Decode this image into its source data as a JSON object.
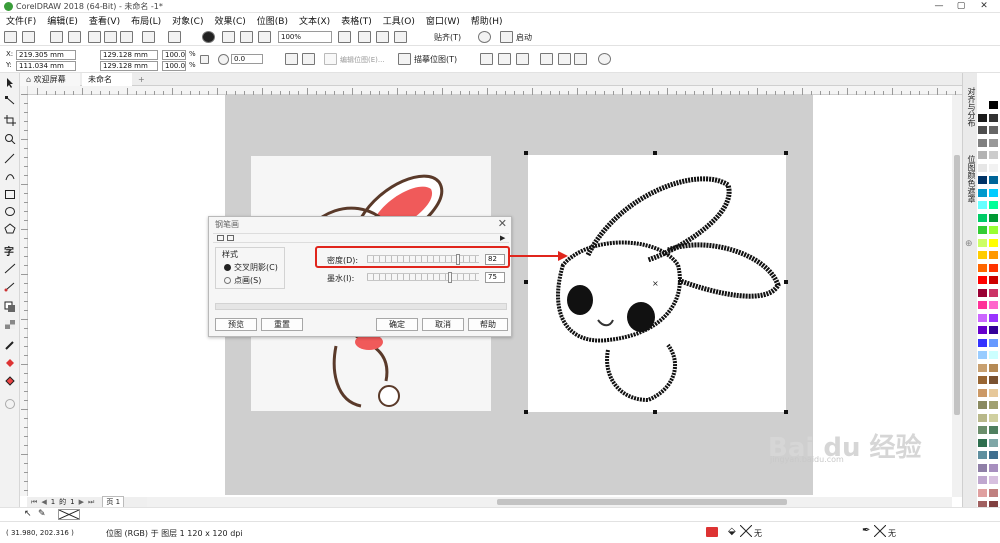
{
  "window": {
    "title": "CorelDRAW 2018 (64-Bit) - 未命名 -1*"
  },
  "menu": [
    "文件(F)",
    "编辑(E)",
    "查看(V)",
    "布局(L)",
    "对象(C)",
    "效果(C)",
    "位图(B)",
    "文本(X)",
    "表格(T)",
    "工具(O)",
    "窗口(W)",
    "帮助(H)"
  ],
  "toolbar": {
    "zoom": "100%",
    "snap_label": "贴齐(T)",
    "launch_label": "启动",
    "x": "219.305 mm",
    "y": "111.034 mm",
    "width": "129.128 mm",
    "height": "129.128 mm",
    "scale_w": "100.0",
    "scale_h": "100.0",
    "percent": "%",
    "rotation": "0.0",
    "edit_bitmap_label": "编辑位图(E)...",
    "trace_bitmap_label": "描摹位图(T)"
  },
  "tabs": {
    "welcome": "欢迎屏幕",
    "document": "未命名 -1*"
  },
  "dock": {
    "panel1": "对齐与分布",
    "panel2": "位图颜色遮罩"
  },
  "dialog": {
    "title": "钢笔画",
    "style_group": "样式",
    "option1": "交叉阴影(C)",
    "option2": "点画(S)",
    "density_label": "密度(D):",
    "density_value": "82",
    "density": 0.82,
    "ink_label": "墨水(I):",
    "ink_value": "75",
    "ink": 0.75,
    "btn_preview": "预览",
    "btn_reset": "重置",
    "btn_ok": "确定",
    "btn_cancel": "取消",
    "btn_help": "帮助"
  },
  "pagenav": {
    "current": "1",
    "of": "的",
    "total": "1",
    "page_tab": "页 1"
  },
  "status": {
    "coords": "( 31.980, 202.316 )",
    "object_info": "位图 (RGB) 于 图层 1 120 x 120 dpi",
    "fill": "无",
    "outline": "无"
  },
  "watermark": {
    "logo": "Bai du 经验",
    "url": "jingyan.baidu.com"
  },
  "colors": {
    "accent_red": "#e0251c",
    "palette": [
      "#ffffff",
      "#000000",
      "#1a1a1a",
      "#333333",
      "#4d4d4d",
      "#666666",
      "#808080",
      "#999999",
      "#b3b3b3",
      "#cccccc",
      "#e6e6e6",
      "#f2f2f2",
      "#003366",
      "#006699",
      "#0099cc",
      "#00ccff",
      "#66ffff",
      "#00ff99",
      "#00cc66",
      "#009933",
      "#33cc33",
      "#99ff33",
      "#ccff66",
      "#ffff00",
      "#ffcc00",
      "#ff9900",
      "#ff6600",
      "#ff3300",
      "#ff0000",
      "#cc0000",
      "#990033",
      "#cc3366",
      "#ff3399",
      "#ff66cc",
      "#cc66ff",
      "#9933ff",
      "#6600cc",
      "#330099",
      "#3333ff",
      "#6699ff",
      "#99ccff",
      "#ccffff",
      "#c8a070",
      "#b58a55",
      "#996633",
      "#7a5230",
      "#cc9966",
      "#e6c89a",
      "#8a8a60",
      "#a0a070",
      "#b8b88a",
      "#d0d0a0",
      "#6b8e6b",
      "#4f7f5f",
      "#2f6f4f",
      "#7fa7a7",
      "#5f8f9f",
      "#3f6f8f",
      "#8f7fa7",
      "#a78fbf",
      "#bfa7cf",
      "#d7c0df",
      "#e0a0a0",
      "#c08080",
      "#a06060",
      "#804040"
    ]
  }
}
